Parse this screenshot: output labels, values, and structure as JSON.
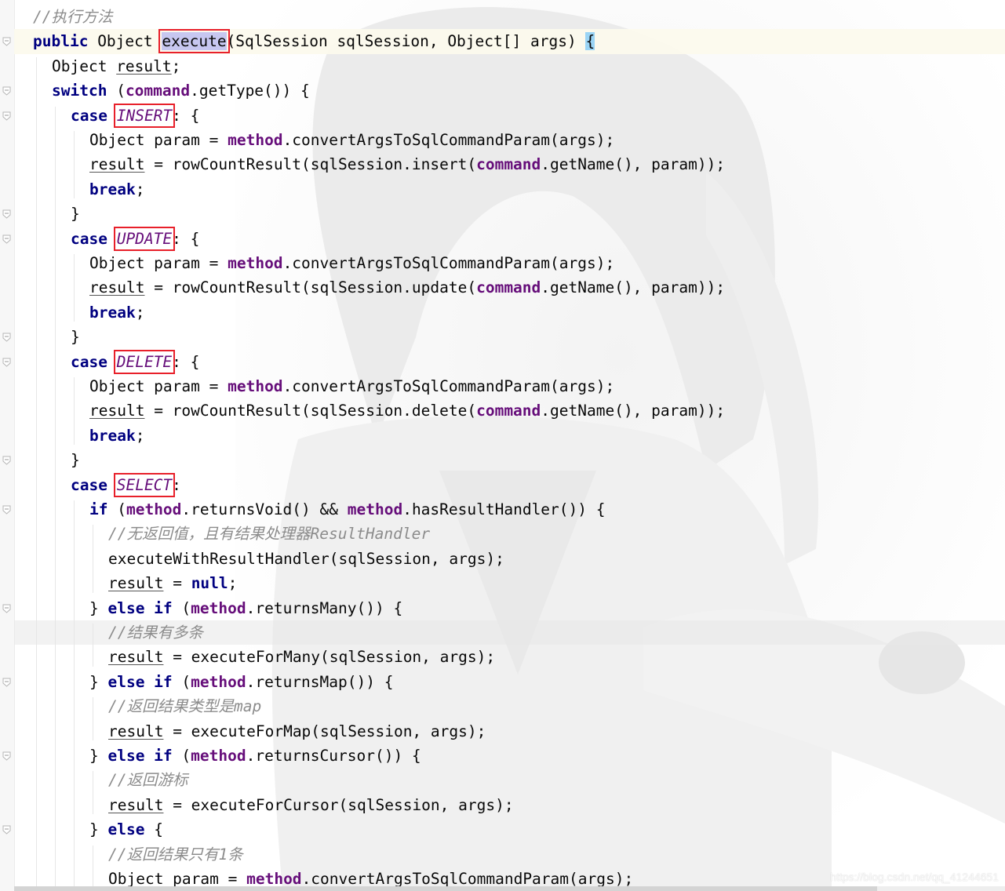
{
  "editor": {
    "lines": [
      {
        "indent": 1,
        "parts": [
          [
            "cmt",
            "//执行方法"
          ]
        ]
      },
      {
        "indent": 1,
        "current": true,
        "parts": [
          [
            "kw",
            "public"
          ],
          [
            "t",
            " Object "
          ],
          [
            "hlbox",
            "execute"
          ],
          [
            "t",
            "(SqlSession sqlSession, Object[] args) "
          ],
          [
            "brace",
            "{"
          ]
        ]
      },
      {
        "indent": 2,
        "parts": [
          [
            "t",
            "Object "
          ],
          [
            "ul",
            "result"
          ],
          [
            "t",
            ";"
          ]
        ]
      },
      {
        "indent": 2,
        "parts": [
          [
            "kw",
            "switch"
          ],
          [
            "t",
            " ("
          ],
          [
            "fld",
            "command"
          ],
          [
            "t",
            ".getType()) {"
          ]
        ]
      },
      {
        "indent": 3,
        "parts": [
          [
            "kw",
            "case"
          ],
          [
            "t",
            " "
          ],
          [
            "cstbox",
            "INSERT"
          ],
          [
            "t",
            ": {"
          ]
        ]
      },
      {
        "indent": 4,
        "parts": [
          [
            "t",
            "Object param = "
          ],
          [
            "fld",
            "method"
          ],
          [
            "t",
            ".convertArgsToSqlCommandParam(args);"
          ]
        ]
      },
      {
        "indent": 4,
        "parts": [
          [
            "ul",
            "result"
          ],
          [
            "t",
            " = rowCountResult(sqlSession.insert("
          ],
          [
            "fld",
            "command"
          ],
          [
            "t",
            ".getName(), param));"
          ]
        ]
      },
      {
        "indent": 4,
        "parts": [
          [
            "kw",
            "break"
          ],
          [
            "t",
            ";"
          ]
        ]
      },
      {
        "indent": 3,
        "parts": [
          [
            "t",
            "}"
          ]
        ]
      },
      {
        "indent": 3,
        "parts": [
          [
            "kw",
            "case"
          ],
          [
            "t",
            " "
          ],
          [
            "cstbox",
            "UPDATE"
          ],
          [
            "t",
            ": {"
          ]
        ]
      },
      {
        "indent": 4,
        "parts": [
          [
            "t",
            "Object param = "
          ],
          [
            "fld",
            "method"
          ],
          [
            "t",
            ".convertArgsToSqlCommandParam(args);"
          ]
        ]
      },
      {
        "indent": 4,
        "parts": [
          [
            "ul",
            "result"
          ],
          [
            "t",
            " = rowCountResult(sqlSession.update("
          ],
          [
            "fld",
            "command"
          ],
          [
            "t",
            ".getName(), param));"
          ]
        ]
      },
      {
        "indent": 4,
        "parts": [
          [
            "kw",
            "break"
          ],
          [
            "t",
            ";"
          ]
        ]
      },
      {
        "indent": 3,
        "parts": [
          [
            "t",
            "}"
          ]
        ]
      },
      {
        "indent": 3,
        "parts": [
          [
            "kw",
            "case"
          ],
          [
            "t",
            " "
          ],
          [
            "cstbox",
            "DELETE"
          ],
          [
            "t",
            ": {"
          ]
        ]
      },
      {
        "indent": 4,
        "parts": [
          [
            "t",
            "Object param = "
          ],
          [
            "fld",
            "method"
          ],
          [
            "t",
            ".convertArgsToSqlCommandParam(args);"
          ]
        ]
      },
      {
        "indent": 4,
        "parts": [
          [
            "ul",
            "result"
          ],
          [
            "t",
            " = rowCountResult(sqlSession.delete("
          ],
          [
            "fld",
            "command"
          ],
          [
            "t",
            ".getName(), param));"
          ]
        ]
      },
      {
        "indent": 4,
        "parts": [
          [
            "kw",
            "break"
          ],
          [
            "t",
            ";"
          ]
        ]
      },
      {
        "indent": 3,
        "parts": [
          [
            "t",
            "}"
          ]
        ]
      },
      {
        "indent": 3,
        "parts": [
          [
            "kw",
            "case"
          ],
          [
            "t",
            " "
          ],
          [
            "cstbox",
            "SELECT"
          ],
          [
            "t",
            ":"
          ]
        ]
      },
      {
        "indent": 4,
        "parts": [
          [
            "kw",
            "if"
          ],
          [
            "t",
            " ("
          ],
          [
            "fld",
            "method"
          ],
          [
            "t",
            ".returnsVoid() && "
          ],
          [
            "fld",
            "method"
          ],
          [
            "t",
            ".hasResultHandler()) {"
          ]
        ]
      },
      {
        "indent": 5,
        "parts": [
          [
            "cmt",
            "//无返回值，且有结果处理器ResultHandler"
          ]
        ]
      },
      {
        "indent": 5,
        "parts": [
          [
            "t",
            "executeWithResultHandler(sqlSession, args);"
          ]
        ]
      },
      {
        "indent": 5,
        "parts": [
          [
            "ul",
            "result"
          ],
          [
            "t",
            " = "
          ],
          [
            "kw",
            "null"
          ],
          [
            "t",
            ";"
          ]
        ]
      },
      {
        "indent": 4,
        "parts": [
          [
            "t",
            "} "
          ],
          [
            "kw",
            "else if"
          ],
          [
            "t",
            " ("
          ],
          [
            "fld",
            "method"
          ],
          [
            "t",
            ".returnsMany()) {"
          ]
        ]
      },
      {
        "indent": 5,
        "caret": true,
        "parts": [
          [
            "cmt",
            "//结果有多条"
          ]
        ]
      },
      {
        "indent": 5,
        "parts": [
          [
            "ul",
            "result"
          ],
          [
            "t",
            " = executeForMany(sqlSession, args);"
          ]
        ]
      },
      {
        "indent": 4,
        "parts": [
          [
            "t",
            "} "
          ],
          [
            "kw",
            "else if"
          ],
          [
            "t",
            " ("
          ],
          [
            "fld",
            "method"
          ],
          [
            "t",
            ".returnsMap()) {"
          ]
        ]
      },
      {
        "indent": 5,
        "parts": [
          [
            "cmt",
            "//返回结果类型是map"
          ]
        ]
      },
      {
        "indent": 5,
        "parts": [
          [
            "ul",
            "result"
          ],
          [
            "t",
            " = executeForMap(sqlSession, args);"
          ]
        ]
      },
      {
        "indent": 4,
        "parts": [
          [
            "t",
            "} "
          ],
          [
            "kw",
            "else if"
          ],
          [
            "t",
            " ("
          ],
          [
            "fld",
            "method"
          ],
          [
            "t",
            ".returnsCursor()) {"
          ]
        ]
      },
      {
        "indent": 5,
        "parts": [
          [
            "cmt",
            "//返回游标"
          ]
        ]
      },
      {
        "indent": 5,
        "parts": [
          [
            "ul",
            "result"
          ],
          [
            "t",
            " = executeForCursor(sqlSession, args);"
          ]
        ]
      },
      {
        "indent": 4,
        "parts": [
          [
            "t",
            "} "
          ],
          [
            "kw",
            "else"
          ],
          [
            "t",
            " {"
          ]
        ]
      },
      {
        "indent": 5,
        "parts": [
          [
            "cmt",
            "//返回结果只有1条"
          ]
        ]
      },
      {
        "indent": 5,
        "parts": [
          [
            "t",
            "Object param = "
          ],
          [
            "fld",
            "method"
          ],
          [
            "t",
            ".convertArgsToSqlCommandParam(args);"
          ]
        ]
      }
    ],
    "folds": [
      1,
      3,
      4,
      8,
      9,
      13,
      14,
      18,
      20,
      24,
      27,
      30,
      33
    ]
  },
  "watermark": "https://blog.csdn.net/qq_41244651",
  "colors": {
    "keyword": "#000080",
    "field": "#660e7a",
    "comment": "#8c8c8c",
    "annotation_box": "#e8202a",
    "current_line": "#fcfaed"
  }
}
